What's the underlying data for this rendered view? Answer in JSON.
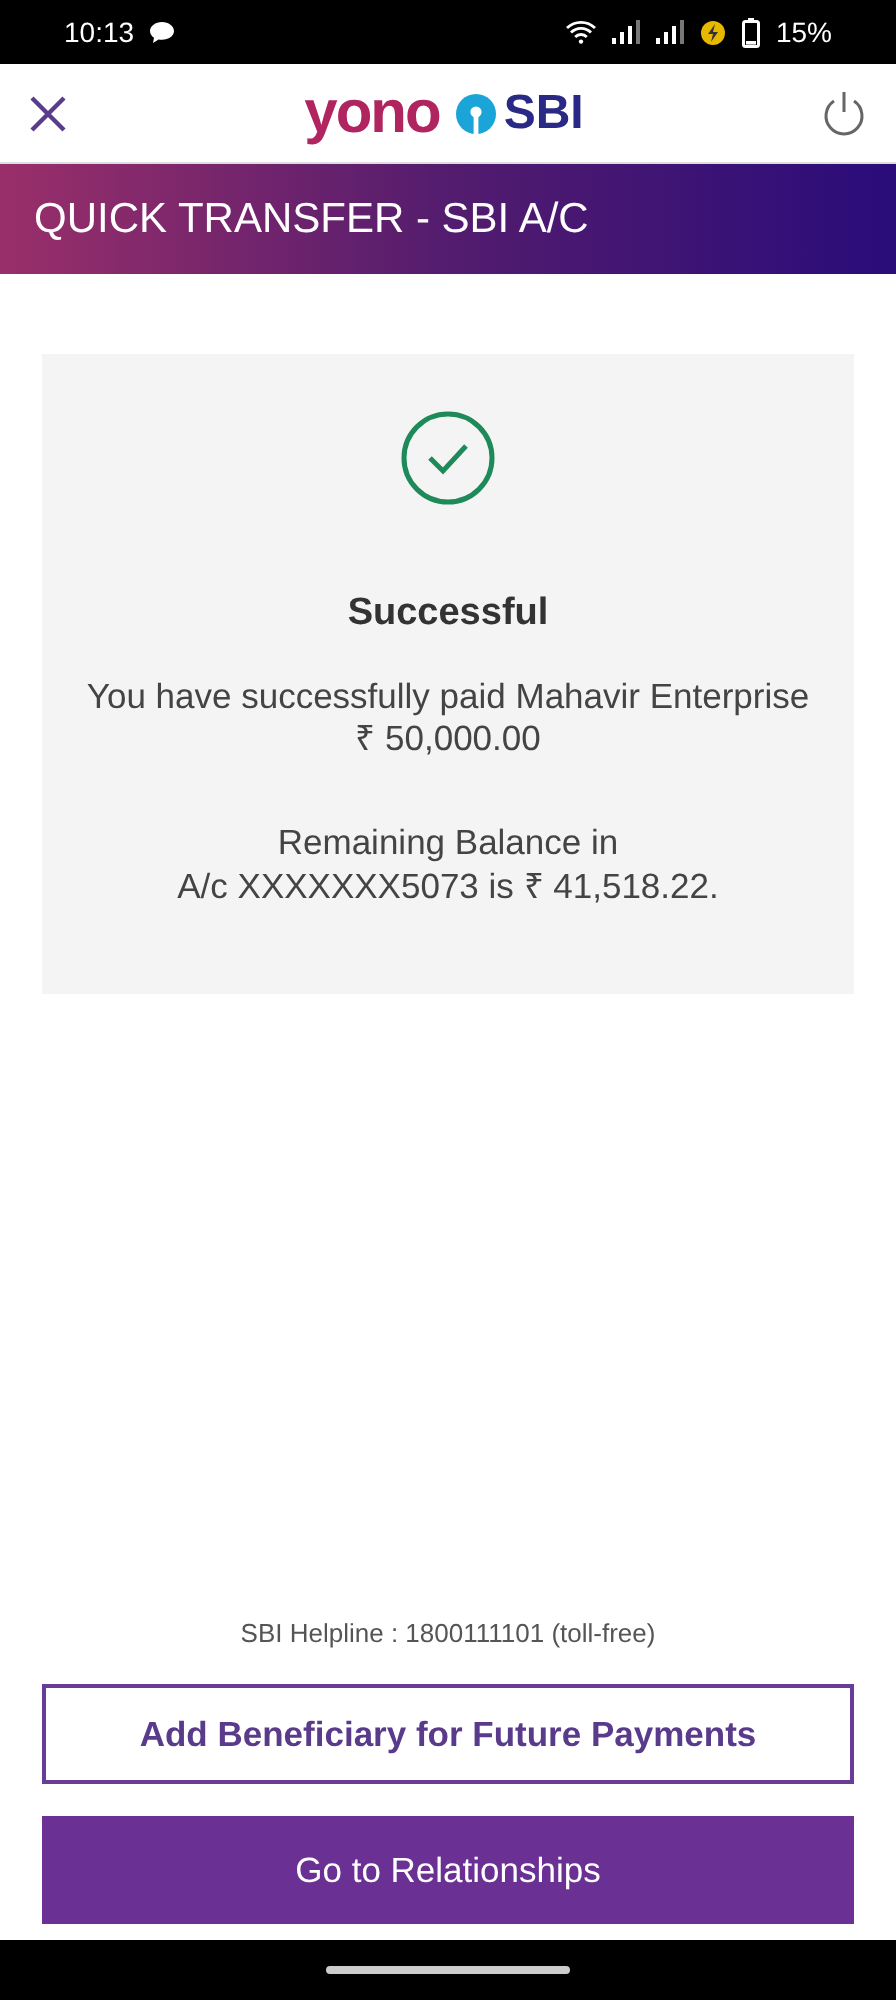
{
  "status_bar": {
    "time": "10:13",
    "battery": "15%"
  },
  "header": {
    "logo_left": "yono",
    "logo_right": "SBI"
  },
  "banner": {
    "title": "QUICK TRANSFER - SBI A/C"
  },
  "result": {
    "title": "Successful",
    "message": "You have successfully paid Mahavir Enterprise",
    "amount": "₹ 50,000.00",
    "balance_line_1": "Remaining Balance in",
    "balance_line_2": "A/c XXXXXXX5073 is ₹ 41,518.22."
  },
  "helpline": "SBI Helpline : 1800111101 (toll-free)",
  "buttons": [
    {
      "label": "Add Beneficiary for Future Payments",
      "kind": "outline"
    },
    {
      "label": "Go to Relationships",
      "kind": "filled"
    }
  ]
}
